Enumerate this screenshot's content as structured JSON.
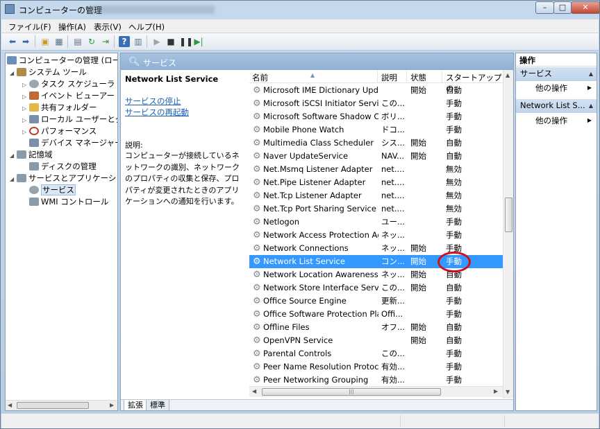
{
  "window": {
    "title": "コンピューターの管理",
    "controls": {
      "minimize": "–",
      "maximize": "□",
      "close": "✕"
    }
  },
  "menu": [
    {
      "label": "ファイル(F)"
    },
    {
      "label": "操作(A)"
    },
    {
      "label": "表示(V)"
    },
    {
      "label": "ヘルプ(H)"
    }
  ],
  "toolbar": {
    "icons": [
      "back-arrow-icon",
      "forward-arrow-icon",
      "up-folder-icon",
      "show-hide-tree-icon",
      "properties-icon",
      "refresh-icon",
      "export-list-icon",
      "help-icon",
      "show-hide-action-pane-icon",
      "play-icon",
      "stop-icon",
      "pause-icon",
      "restart-icon"
    ]
  },
  "tree": {
    "items": [
      {
        "label": "コンピューターの管理 (ローカ",
        "level": 0,
        "twisty": "",
        "icon_color": "#6b8fb8"
      },
      {
        "label": "システム ツール",
        "level": 1,
        "twisty": "◢",
        "icon_color": "#b08a4a"
      },
      {
        "label": "タスク スケジューラ",
        "level": 2,
        "twisty": "▷",
        "icon_color": "#9aa7b3"
      },
      {
        "label": "イベント ビューアー",
        "level": 2,
        "twisty": "▷",
        "icon_color": "#c06a3a"
      },
      {
        "label": "共有フォルダー",
        "level": 2,
        "twisty": "▷",
        "icon_color": "#e1b84a"
      },
      {
        "label": "ローカル ユーザーとグ",
        "level": 2,
        "twisty": "▷",
        "icon_color": "#7a8fa8"
      },
      {
        "label": "パフォーマンス",
        "level": 2,
        "twisty": "▷",
        "icon_color": "#c23a2a"
      },
      {
        "label": "デバイス マネージャー",
        "level": 2,
        "twisty": "",
        "icon_color": "#7a8fa8"
      },
      {
        "label": "記憶域",
        "level": 1,
        "twisty": "◢",
        "icon_color": "#8a9aa8"
      },
      {
        "label": "ディスクの管理",
        "level": 2,
        "twisty": "",
        "icon_color": "#8a9aa8"
      },
      {
        "label": "サービスとアプリケーショ",
        "level": 1,
        "twisty": "◢",
        "icon_color": "#8a9aa8"
      },
      {
        "label": "サービス",
        "level": 2,
        "twisty": "",
        "icon_color": "#9aa3ad",
        "selected": true
      },
      {
        "label": "WMI コントロール",
        "level": 2,
        "twisty": "",
        "icon_color": "#8a9aa8"
      }
    ]
  },
  "center": {
    "header": "サービス",
    "selected_service": "Network List Service",
    "links": [
      "サービスの停止",
      "サービスの再起動"
    ],
    "description_label": "説明:",
    "description": "コンピューターが接続しているネットワークの識別、ネットワークのプロパティの収集と保存、プロパティが変更されたときのアプリケーションへの通知を行います。",
    "columns": [
      "名前",
      "説明",
      "状態",
      "スタートアップの"
    ],
    "rows": [
      {
        "name": "Microsoft IME Dictionary Update",
        "desc": "",
        "status": "開始",
        "startup": "自動"
      },
      {
        "name": "Microsoft iSCSI Initiator Service",
        "desc": "この...",
        "status": "",
        "startup": "手動"
      },
      {
        "name": "Microsoft Software Shadow C...",
        "desc": "ボリ...",
        "status": "",
        "startup": "手動"
      },
      {
        "name": "Mobile Phone Watch",
        "desc": "ドコ...",
        "status": "",
        "startup": "手動"
      },
      {
        "name": "Multimedia Class Scheduler",
        "desc": "シス...",
        "status": "開始",
        "startup": "自動"
      },
      {
        "name": "Naver UpdateService",
        "desc": "NAV...",
        "status": "開始",
        "startup": "自動"
      },
      {
        "name": "Net.Msmq Listener Adapter",
        "desc": "net....",
        "status": "",
        "startup": "無効"
      },
      {
        "name": "Net.Pipe Listener Adapter",
        "desc": "net....",
        "status": "",
        "startup": "無効"
      },
      {
        "name": "Net.Tcp Listener Adapter",
        "desc": "net....",
        "status": "",
        "startup": "無効"
      },
      {
        "name": "Net.Tcp Port Sharing Service",
        "desc": "net....",
        "status": "",
        "startup": "無効"
      },
      {
        "name": "Netlogon",
        "desc": "ユー...",
        "status": "",
        "startup": "手動"
      },
      {
        "name": "Network Access Protection Ag...",
        "desc": "ネッ...",
        "status": "",
        "startup": "手動"
      },
      {
        "name": "Network Connections",
        "desc": "ネッ...",
        "status": "開始",
        "startup": "手動"
      },
      {
        "name": "Network List Service",
        "desc": "コン...",
        "status": "開始",
        "startup": "手動",
        "selected": true
      },
      {
        "name": "Network Location Awareness",
        "desc": "ネッ...",
        "status": "開始",
        "startup": "自動"
      },
      {
        "name": "Network Store Interface Servi...",
        "desc": "この...",
        "status": "開始",
        "startup": "自動"
      },
      {
        "name": "Office  Source Engine",
        "desc": "更新...",
        "status": "",
        "startup": "手動"
      },
      {
        "name": "Office Software Protection Pla...",
        "desc": "Offi...",
        "status": "",
        "startup": "手動"
      },
      {
        "name": "Offline Files",
        "desc": "オフ...",
        "status": "開始",
        "startup": "自動"
      },
      {
        "name": "OpenVPN Service",
        "desc": "",
        "status": "開始",
        "startup": "自動"
      },
      {
        "name": "Parental Controls",
        "desc": "この...",
        "status": "",
        "startup": "手動"
      },
      {
        "name": "Peer Name Resolution Protocol",
        "desc": "有効...",
        "status": "",
        "startup": "手動"
      },
      {
        "name": "Peer Networking Grouping",
        "desc": "有効...",
        "status": "",
        "startup": "手動"
      }
    ],
    "tabs": [
      "拡張",
      "標準"
    ],
    "hscroll_grip": "|||"
  },
  "actions": {
    "header": "操作",
    "groups": [
      {
        "title": "サービス",
        "item": "他の操作"
      },
      {
        "title": "Network List S...",
        "item": "他の操作"
      }
    ]
  },
  "annotation": {
    "color": "#d0101a"
  }
}
